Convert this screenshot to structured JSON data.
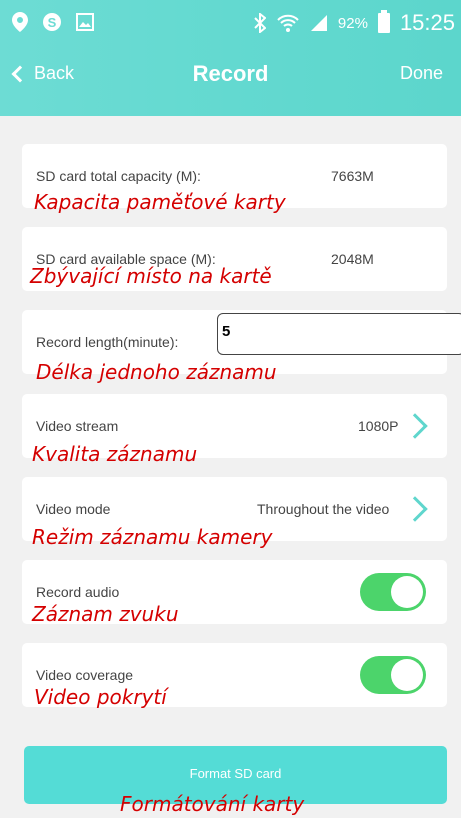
{
  "status_bar": {
    "battery": "92%",
    "time": "15:25"
  },
  "nav": {
    "back_label": "Back",
    "title": "Record",
    "done_label": "Done"
  },
  "rows": {
    "capacity": {
      "label": "SD card total capacity (M):",
      "value": "7663M",
      "note": "Kapacita paměťové karty"
    },
    "available": {
      "label": "SD card available space (M):",
      "value": "2048M",
      "note": "Zbývající místo na kartě"
    },
    "length": {
      "label": "Record length(minute):",
      "value": "5",
      "note": "Délka jednoho záznamu"
    },
    "stream": {
      "label": "Video stream",
      "value": "1080P",
      "note": "Kvalita záznamu"
    },
    "mode": {
      "label": "Video mode",
      "value": "Throughout the video",
      "note": "Režim záznamu kamery"
    },
    "audio": {
      "label": "Record audio",
      "value": "on",
      "note": "Záznam zvuku"
    },
    "coverage": {
      "label": "Video coverage",
      "value": "on",
      "note": "Video pokrytí"
    }
  },
  "format": {
    "label": "Format SD card",
    "note": "Formátování karty"
  },
  "colors": {
    "accent": "#5fd6cd",
    "toggle_on": "#4cd46b",
    "annotation": "#d40000"
  }
}
